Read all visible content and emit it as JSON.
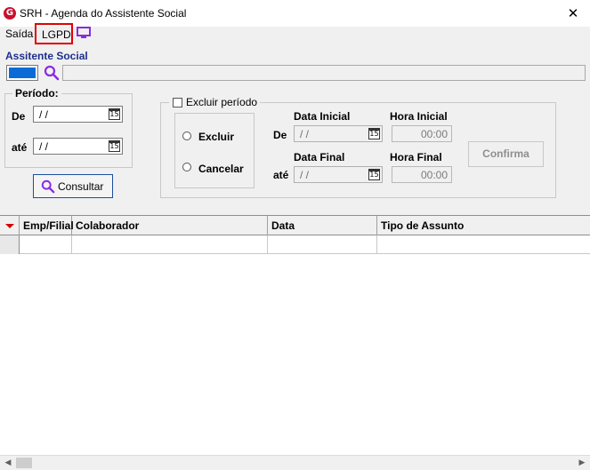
{
  "window": {
    "title": "SRH - Agenda do Assistente Social",
    "app_icon_glyph": "G",
    "close_glyph": "✕"
  },
  "menu": {
    "items": [
      "Saída",
      "LGPD"
    ],
    "highlight_color": "#e00000"
  },
  "assistente": {
    "label": "Assitente Social"
  },
  "periodo": {
    "legend": "Período:",
    "de_label": "De",
    "ate_label": "até",
    "de_value": " / /",
    "ate_value": " / /",
    "cal_glyph": "15"
  },
  "consultar": {
    "label": "Consultar"
  },
  "excluir": {
    "checkbox_label": "Excluir período",
    "radio_excluir": "Excluir",
    "radio_cancelar": "Cancelar",
    "data_inicial_label": "Data Inicial",
    "hora_inicial_label": "Hora Inicial",
    "data_final_label": "Data Final",
    "hora_final_label": "Hora Final",
    "de_label": "De",
    "ate_label": "até",
    "data_inicial_value": " / /",
    "data_final_value": " / /",
    "hora_inicial_value": "00:00",
    "hora_final_value": "00:00",
    "confirma_label": "Confirma"
  },
  "grid": {
    "columns": [
      "Emp/Filial",
      "Colaborador",
      "Data",
      "Tipo de Assunto"
    ]
  },
  "colors": {
    "accent": "#1e2f8c",
    "icon_purple": "#8a2be2",
    "selection": "#0a6bd6"
  }
}
